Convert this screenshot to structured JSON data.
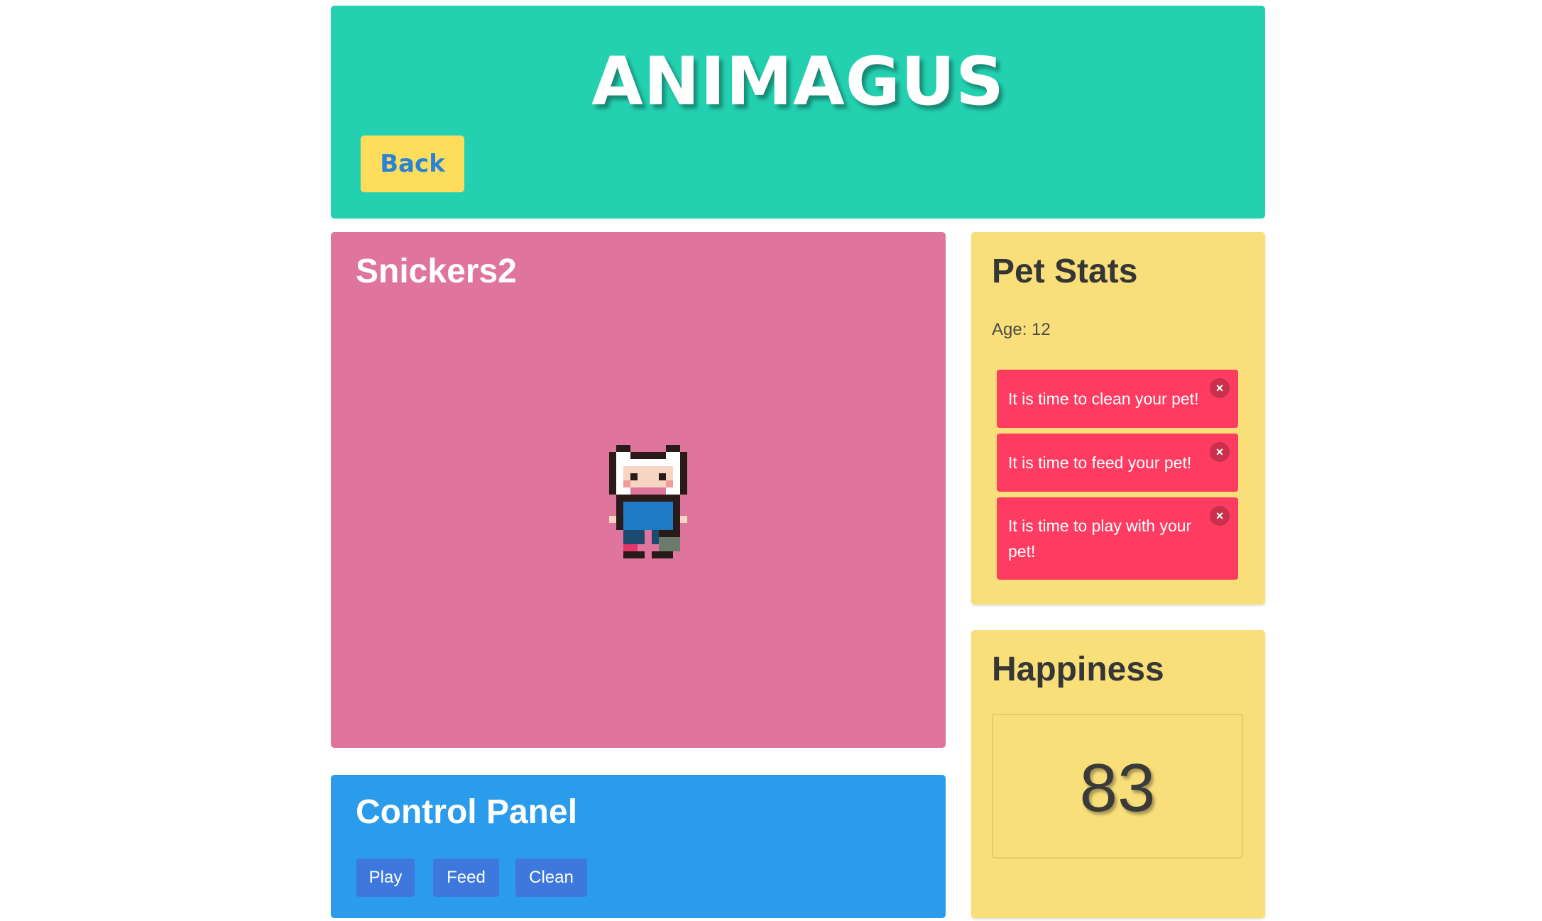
{
  "header": {
    "title": "ANIMAGUS",
    "back_label": "Back"
  },
  "pet": {
    "name": "Snickers2"
  },
  "control_panel": {
    "title": "Control Panel",
    "buttons": {
      "play": "Play",
      "feed": "Feed",
      "clean": "Clean"
    }
  },
  "stats": {
    "title": "Pet Stats",
    "age": "Age: 12",
    "notifications": [
      "It is time to clean your pet!",
      "It is time to feed your pet!",
      "It is time to play with your pet!"
    ],
    "close_icon": "×"
  },
  "happiness": {
    "title": "Happiness",
    "value": "83"
  },
  "colors": {
    "header_bg": "#23d1b1",
    "back_button_bg": "#ffdd5c",
    "pet_panel_bg": "#df759c",
    "control_panel_bg": "#2b9ceb",
    "control_button_bg": "#3e78dc",
    "stats_bg": "#f9df7a",
    "notification_bg": "#fe3b61"
  }
}
